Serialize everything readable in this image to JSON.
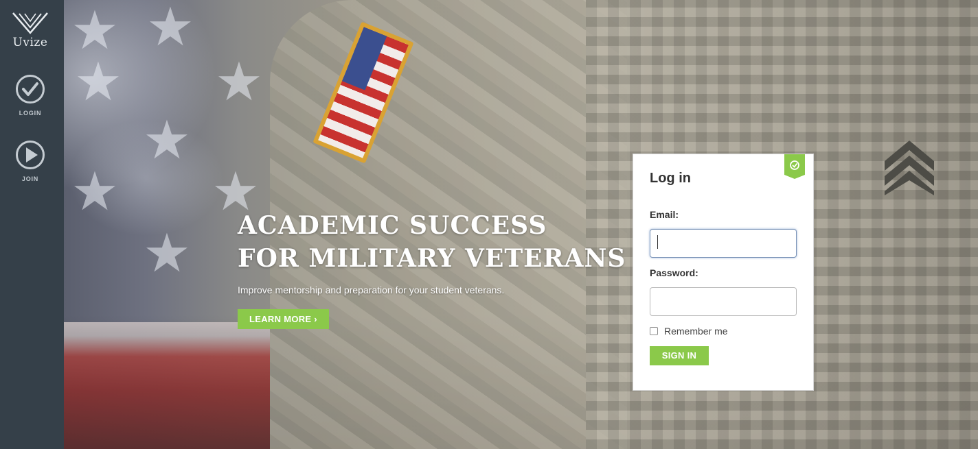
{
  "app": {
    "name": "Uvize"
  },
  "sidebar": {
    "items": [
      {
        "label": "LOGIN",
        "icon": "check-circle-icon"
      },
      {
        "label": "JOIN",
        "icon": "play-circle-icon"
      }
    ]
  },
  "hero": {
    "title_line1": "ACADEMIC SUCCESS",
    "title_line2": "FOR MILITARY VETERANS",
    "subtitle": "Improve mentorship and preparation for your student veterans.",
    "cta_label": "LEARN MORE ›"
  },
  "login": {
    "title": "Log in",
    "email_label": "Email:",
    "email_value": "",
    "password_label": "Password:",
    "password_value": "",
    "remember_label": "Remember me",
    "remember_checked": false,
    "submit_label": "SIGN IN",
    "badge_icon": "check-circle-icon"
  },
  "colors": {
    "sidebar_bg": "#354049",
    "accent_green": "#8bc94a"
  }
}
